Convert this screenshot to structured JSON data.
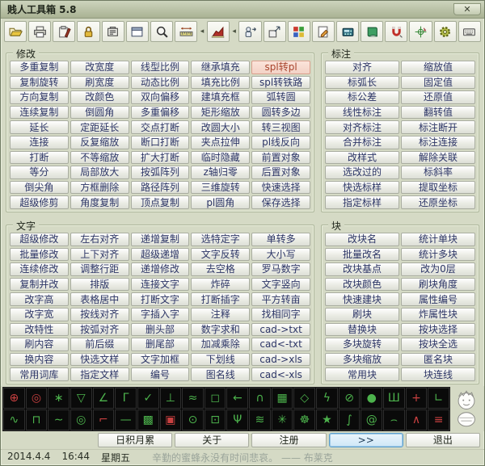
{
  "window": {
    "title": "贱人工具箱 5.8",
    "close_glyph": "✕"
  },
  "toolbar": {
    "collapse_glyph": "◂",
    "icons": [
      "open-file",
      "print",
      "format-brush",
      "lock",
      "purge",
      "window",
      "zoom",
      "measure",
      "chart",
      "user-switch",
      "link",
      "colors",
      "edit-doc",
      "calculator",
      "notebook",
      "magnet",
      "rotate-axis",
      "settings-gear",
      "keyboard"
    ]
  },
  "sections": {
    "modify": {
      "title": "修改",
      "highlight": "spl转pl",
      "columns": [
        [
          "多重复制",
          "复制旋转",
          "方向复制",
          "连续复制",
          "延长",
          "连接",
          "打断",
          "等分",
          "倒尖角",
          "超级修剪"
        ],
        [
          "改宽度",
          "刷宽度",
          "改颜色",
          "倒圆角",
          "定距延长",
          "反复缩放",
          "不等缩放",
          "局部放大",
          "方框删除",
          "角度复制"
        ],
        [
          "线型比例",
          "动态比例",
          "双向偏移",
          "多重偏移",
          "交点打断",
          "断口打断",
          "扩大打断",
          "按弧阵列",
          "路径阵列",
          "顶点复制"
        ],
        [
          "继承填充",
          "填充比例",
          "建填充框",
          "矩形缩放",
          "改圆大小",
          "夹点拉伸",
          "临时隐藏",
          "z轴归零",
          "三维旋转",
          "pl圆角"
        ],
        [
          "spl转pl",
          "spl转铁路",
          "弧转圆",
          "圆转多边",
          "转三视图",
          "pl线反向",
          "前置对象",
          "后置对象",
          "快速选择",
          "保存选择"
        ]
      ]
    },
    "dimension": {
      "title": "标注",
      "columns": [
        [
          "对齐",
          "标弧长",
          "标公差",
          "线性标注",
          "对齐标注",
          "合并标注",
          "改样式",
          "选改过的",
          "快选标样",
          "指定标样"
        ],
        [
          "缩放值",
          "固定值",
          "还原值",
          "翻转值",
          "标注断开",
          "标注连接",
          "解除关联",
          "标斜率",
          "提取坐标",
          "还原坐标"
        ]
      ]
    },
    "text": {
      "title": "文字",
      "columns": [
        [
          "超级修改",
          "批量修改",
          "连续修改",
          "复制并改",
          "改字高",
          "改字宽",
          "改特性",
          "刷内容",
          "换内容",
          "常用词库"
        ],
        [
          "左右对齐",
          "上下对齐",
          "调整行距",
          "排版",
          "表格居中",
          "按线对齐",
          "按弧对齐",
          "前后缀",
          "快选文样",
          "指定文样"
        ],
        [
          "递增复制",
          "超级递增",
          "递增修改",
          "连接文字",
          "打断文字",
          "字插入字",
          "删头部",
          "删尾部",
          "文字加框",
          "编号"
        ],
        [
          "选特定字",
          "文字反转",
          "去空格",
          "炸碎",
          "打断插字",
          "注释",
          "数字求和",
          "加减乘除",
          "下划线",
          "图名线"
        ],
        [
          "单转多",
          "大小写",
          "罗马数字",
          "文字竖向",
          "平方转亩",
          "找相同字",
          "cad->txt",
          "cad<-txt",
          "cad->xls",
          "cad<-xls"
        ]
      ]
    },
    "block": {
      "title": "块",
      "columns": [
        [
          "改块名",
          "批量改名",
          "改块基点",
          "改块颜色",
          "快速建块",
          "刷块",
          "替换块",
          "多块旋转",
          "多块缩放",
          "常用块"
        ],
        [
          "统计单块",
          "统计多块",
          "改为0层",
          "刷块角度",
          "属性编号",
          "炸属性块",
          "按块选择",
          "按块全选",
          "匿名块",
          "块连线"
        ]
      ]
    }
  },
  "palette": {
    "rows": [
      [
        {
          "name": "center-mark",
          "glyph": "⊕",
          "color": "#c84040"
        },
        {
          "name": "target-mark",
          "glyph": "◎",
          "color": "#c84040"
        },
        {
          "name": "section-symbol",
          "glyph": "∗",
          "color": "#4cb24c"
        },
        {
          "name": "weld-mark",
          "glyph": "▽",
          "color": "#4cb24c"
        },
        {
          "name": "slope-mark",
          "glyph": "∠",
          "color": "#4cb24c"
        },
        {
          "name": "axis-frame",
          "glyph": "Γ",
          "color": "#4cb24c"
        },
        {
          "name": "check-mark",
          "glyph": "✓",
          "color": "#4cb24c"
        },
        {
          "name": "lamp-symbol",
          "glyph": "⊥",
          "color": "#4cb24c"
        },
        {
          "name": "revision-cloud",
          "glyph": "≈",
          "color": "#4cb24c"
        },
        {
          "name": "callout",
          "glyph": "◻",
          "color": "#4cb24c"
        },
        {
          "name": "arrow-left",
          "glyph": "←",
          "color": "#4cb24c"
        },
        {
          "name": "curve",
          "glyph": "∩",
          "color": "#4cb24c"
        },
        {
          "name": "table",
          "glyph": "▦",
          "color": "#4cb24c"
        },
        {
          "name": "star4",
          "glyph": "◇",
          "color": "#4cb24c"
        },
        {
          "name": "zigzag",
          "glyph": "ϟ",
          "color": "#4cb24c"
        },
        {
          "name": "gauge",
          "glyph": "⊘",
          "color": "#4cb24c"
        },
        {
          "name": "dot",
          "glyph": "●",
          "color": "#4cb24c"
        },
        {
          "name": "comb",
          "glyph": "Ш",
          "color": "#4cb24c"
        },
        {
          "name": "cross",
          "glyph": "+",
          "color": "#c84040"
        },
        {
          "name": "angle-line",
          "glyph": "∟",
          "color": "#4cb24c"
        }
      ],
      [
        {
          "name": "spring",
          "glyph": "∿",
          "color": "#4cb24c"
        },
        {
          "name": "square-wave",
          "glyph": "⊓",
          "color": "#4cb24c"
        },
        {
          "name": "wave",
          "glyph": "∼",
          "color": "#4cb24c"
        },
        {
          "name": "concentric",
          "glyph": "◎",
          "color": "#4cb24c"
        },
        {
          "name": "flag-line",
          "glyph": "⌐",
          "color": "#c84040"
        },
        {
          "name": "dash",
          "glyph": "—",
          "color": "#4cb24c"
        },
        {
          "name": "hatch",
          "glyph": "▩",
          "color": "#4cb24c"
        },
        {
          "name": "solid-square",
          "glyph": "▣",
          "color": "#c84040"
        },
        {
          "name": "clock",
          "glyph": "⊙",
          "color": "#4cb24c"
        },
        {
          "name": "dot-box",
          "glyph": "⊡",
          "color": "#4cb24c"
        },
        {
          "name": "branch",
          "glyph": "Ψ",
          "color": "#4cb24c"
        },
        {
          "name": "noise",
          "glyph": "≋",
          "color": "#4cb24c"
        },
        {
          "name": "gear-flower",
          "glyph": "✳",
          "color": "#4cb24c"
        },
        {
          "name": "gear-star",
          "glyph": "☸",
          "color": "#4cb24c"
        },
        {
          "name": "star-circle",
          "glyph": "★",
          "color": "#4cb24c"
        },
        {
          "name": "step-line",
          "glyph": "∫",
          "color": "#4cb24c"
        },
        {
          "name": "spiral",
          "glyph": "@",
          "color": "#4cb24c"
        },
        {
          "name": "meter",
          "glyph": "⌢",
          "color": "#4cb24c"
        },
        {
          "name": "peak",
          "glyph": "∧",
          "color": "#c84040"
        },
        {
          "name": "equals",
          "glyph": "≡",
          "color": "#c84040"
        }
      ]
    ]
  },
  "footer": {
    "buttons": [
      {
        "name": "tips-button",
        "label": "日积月累",
        "emphasized": false
      },
      {
        "name": "about-button",
        "label": "关于",
        "emphasized": false
      },
      {
        "name": "register-button",
        "label": "注册",
        "emphasized": false
      },
      {
        "name": "more-button",
        "label": ">>",
        "emphasized": true
      },
      {
        "name": "exit-button",
        "label": "退出",
        "emphasized": false
      }
    ]
  },
  "statusbar": {
    "date": "2014.4.4",
    "time": "16:44",
    "weekday": "星期五",
    "motto": "辛勤的蜜蜂永没有时间悲哀。 —— 布莱克"
  }
}
